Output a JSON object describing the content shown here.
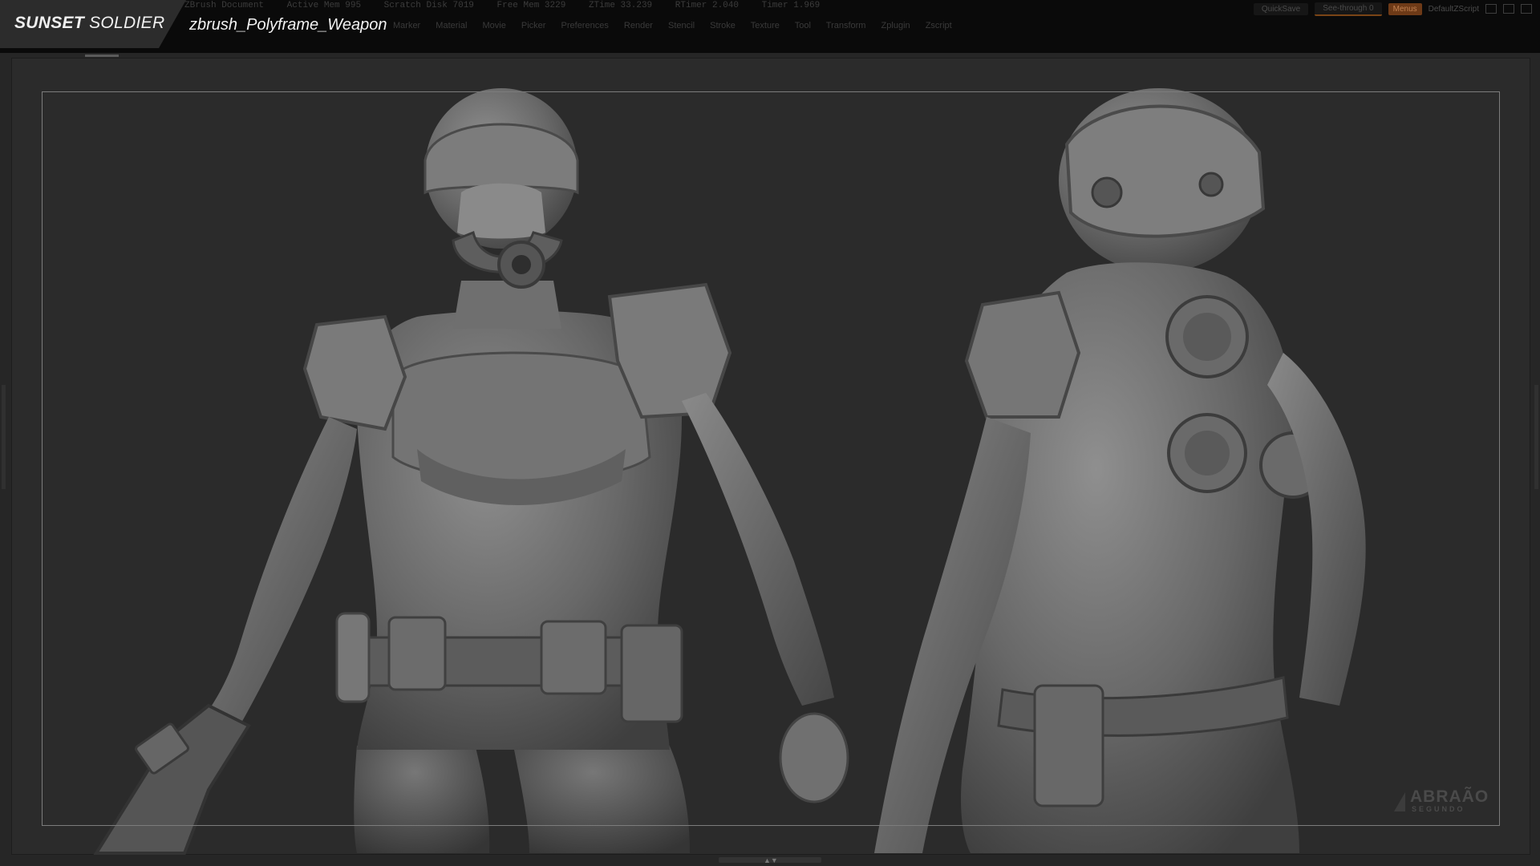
{
  "brand": {
    "name_bold": "SUNSET",
    "name_light": " SOLDIER"
  },
  "document_title": "zbrush_Polyframe_Weapon",
  "titlebar": {
    "items": [
      "ZBrush Document",
      "Active Mem 995",
      "Scratch Disk 7019",
      "Free Mem 3229",
      "ZTime 33.239",
      "RTimer 2.040",
      "Timer 1.969"
    ]
  },
  "menu": {
    "items": [
      "Marker",
      "Material",
      "Movie",
      "Picker",
      "Preferences",
      "Render",
      "Stencil",
      "Stroke",
      "Texture",
      "Tool",
      "Transform",
      "Zplugin",
      "Zscript"
    ]
  },
  "toolbar": {
    "quicksave": "QuickSave",
    "see_through": "See-through 0",
    "menus": "Menus",
    "default_script": "DefaultZScript"
  },
  "watermark": {
    "name": "ABRAÃO",
    "sub": "SEGUNDO"
  },
  "colors": {
    "background": "#262626",
    "topbar": "#0a0a0a",
    "brand_tab": "#2c2c2c",
    "accent": "#7a4416",
    "frame": "#7c7c7c"
  },
  "icons": [
    "window-minimize-icon",
    "window-restore-icon",
    "window-close-icon",
    "sculpt-render-image"
  ]
}
